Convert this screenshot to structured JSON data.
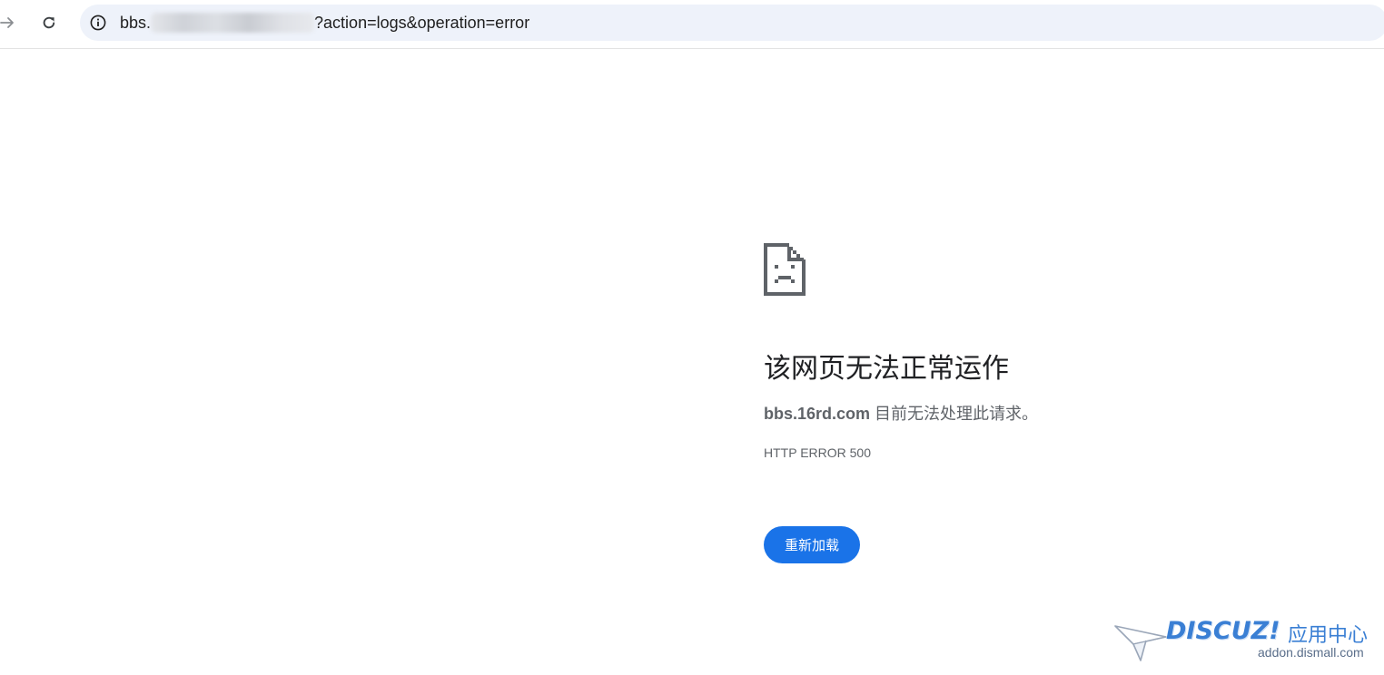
{
  "browser": {
    "address_bar": {
      "url_prefix": "bbs.",
      "url_suffix": "?action=logs&operation=error"
    }
  },
  "error_page": {
    "headline": "该网页无法正常运作",
    "detail_host": "bbs.16rd.com",
    "detail_text": " 目前无法处理此请求。",
    "error_code": "HTTP ERROR 500",
    "reload_button_label": "重新加载"
  },
  "watermark": {
    "brand": "DISCUZ!",
    "brand_cn": "应用中心",
    "domain": "addon.dismall.com"
  },
  "colors": {
    "accent": "#1a73e8",
    "omnibox_bg": "#eef2fa",
    "text_secondary": "#5f6368",
    "watermark_blue": "#3a7fd4"
  },
  "icons": {
    "forward": "arrow-forward-icon",
    "reload": "reload-icon",
    "site_info": "info-icon",
    "sad_tab": "sad-page-icon",
    "watermark_plane": "paper-plane-icon"
  }
}
